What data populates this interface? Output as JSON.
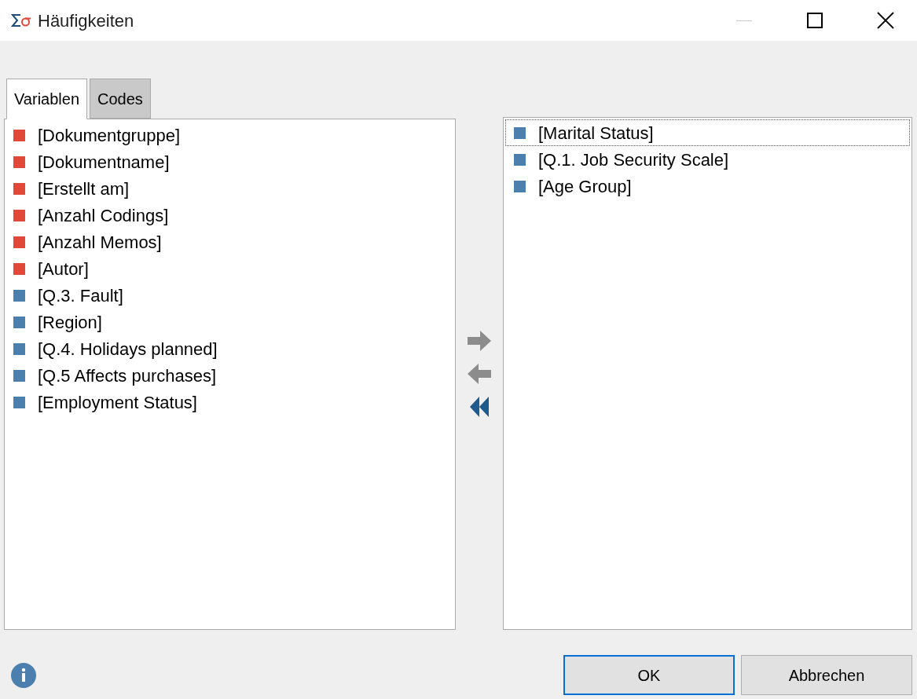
{
  "window": {
    "title": "Häufigkeiten",
    "minimize_disabled": true
  },
  "tabs": [
    {
      "label": "Variablen",
      "selected": true
    },
    {
      "label": "Codes",
      "selected": false
    }
  ],
  "available": [
    {
      "label": "[Dokumentgruppe]",
      "color": "#e2483a"
    },
    {
      "label": "[Dokumentname]",
      "color": "#e2483a"
    },
    {
      "label": "[Erstellt am]",
      "color": "#e2483a"
    },
    {
      "label": "[Anzahl Codings]",
      "color": "#e2483a"
    },
    {
      "label": "[Anzahl Memos]",
      "color": "#e2483a"
    },
    {
      "label": "[Autor]",
      "color": "#e2483a"
    },
    {
      "label": "[Q.3. Fault]",
      "color": "#4b80ae"
    },
    {
      "label": "[Region]",
      "color": "#4b80ae"
    },
    {
      "label": "[Q.4. Holidays planned]",
      "color": "#4b80ae"
    },
    {
      "label": "[Q.5 Affects purchases]",
      "color": "#4b80ae"
    },
    {
      "label": "[Employment Status]",
      "color": "#4b80ae"
    }
  ],
  "chosen": [
    {
      "label": "[Marital Status]",
      "color": "#4b80ae",
      "selected": true
    },
    {
      "label": "[Q.1. Job Security Scale]",
      "color": "#4b80ae",
      "selected": false
    },
    {
      "label": "[Age Group]",
      "color": "#4b80ae",
      "selected": false
    }
  ],
  "buttons": [
    {
      "label": "OK",
      "selected": true
    },
    {
      "label": "Abbrechen",
      "selected": false
    }
  ]
}
